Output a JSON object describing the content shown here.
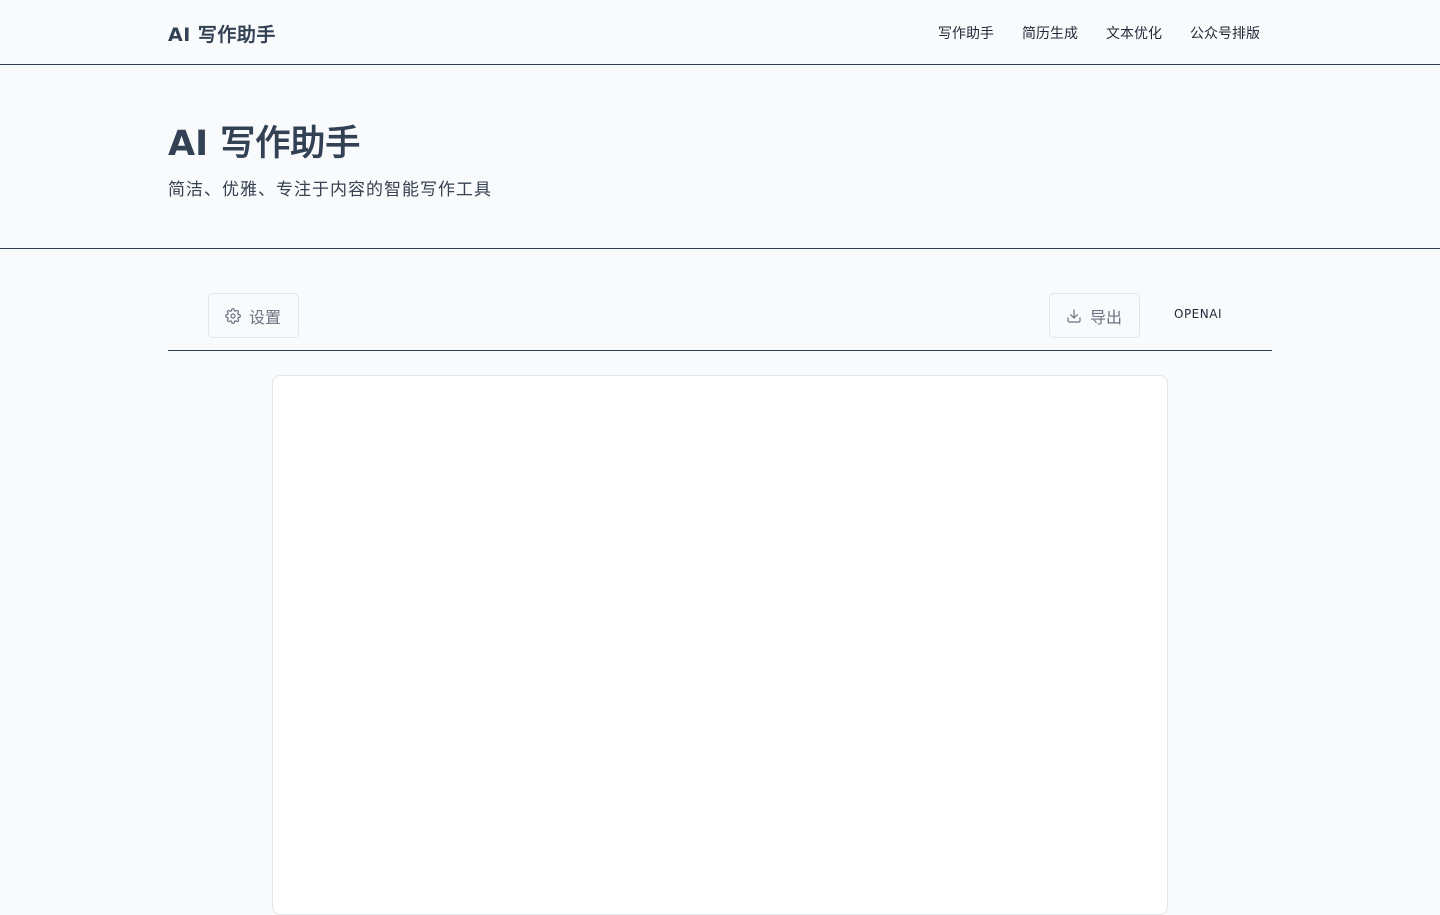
{
  "header": {
    "brand": "AI 写作助手",
    "nav": [
      {
        "label": "写作助手"
      },
      {
        "label": "简历生成"
      },
      {
        "label": "文本优化"
      },
      {
        "label": "公众号排版"
      }
    ]
  },
  "hero": {
    "title": "AI 写作助手",
    "subtitle": "简洁、优雅、专注于内容的智能写作工具"
  },
  "toolbar": {
    "settings_label": "设置",
    "settings_icon": "gear-icon",
    "export_label": "导出",
    "export_icon": "download-icon",
    "provider": "OPENAI"
  },
  "editor": {
    "content": ""
  },
  "colors": {
    "background": "#f9fafb",
    "text_primary": "#334155",
    "border_dark": "#2f3e4e",
    "button_border": "#e2e5e9",
    "editor_bg": "#ffffff"
  }
}
